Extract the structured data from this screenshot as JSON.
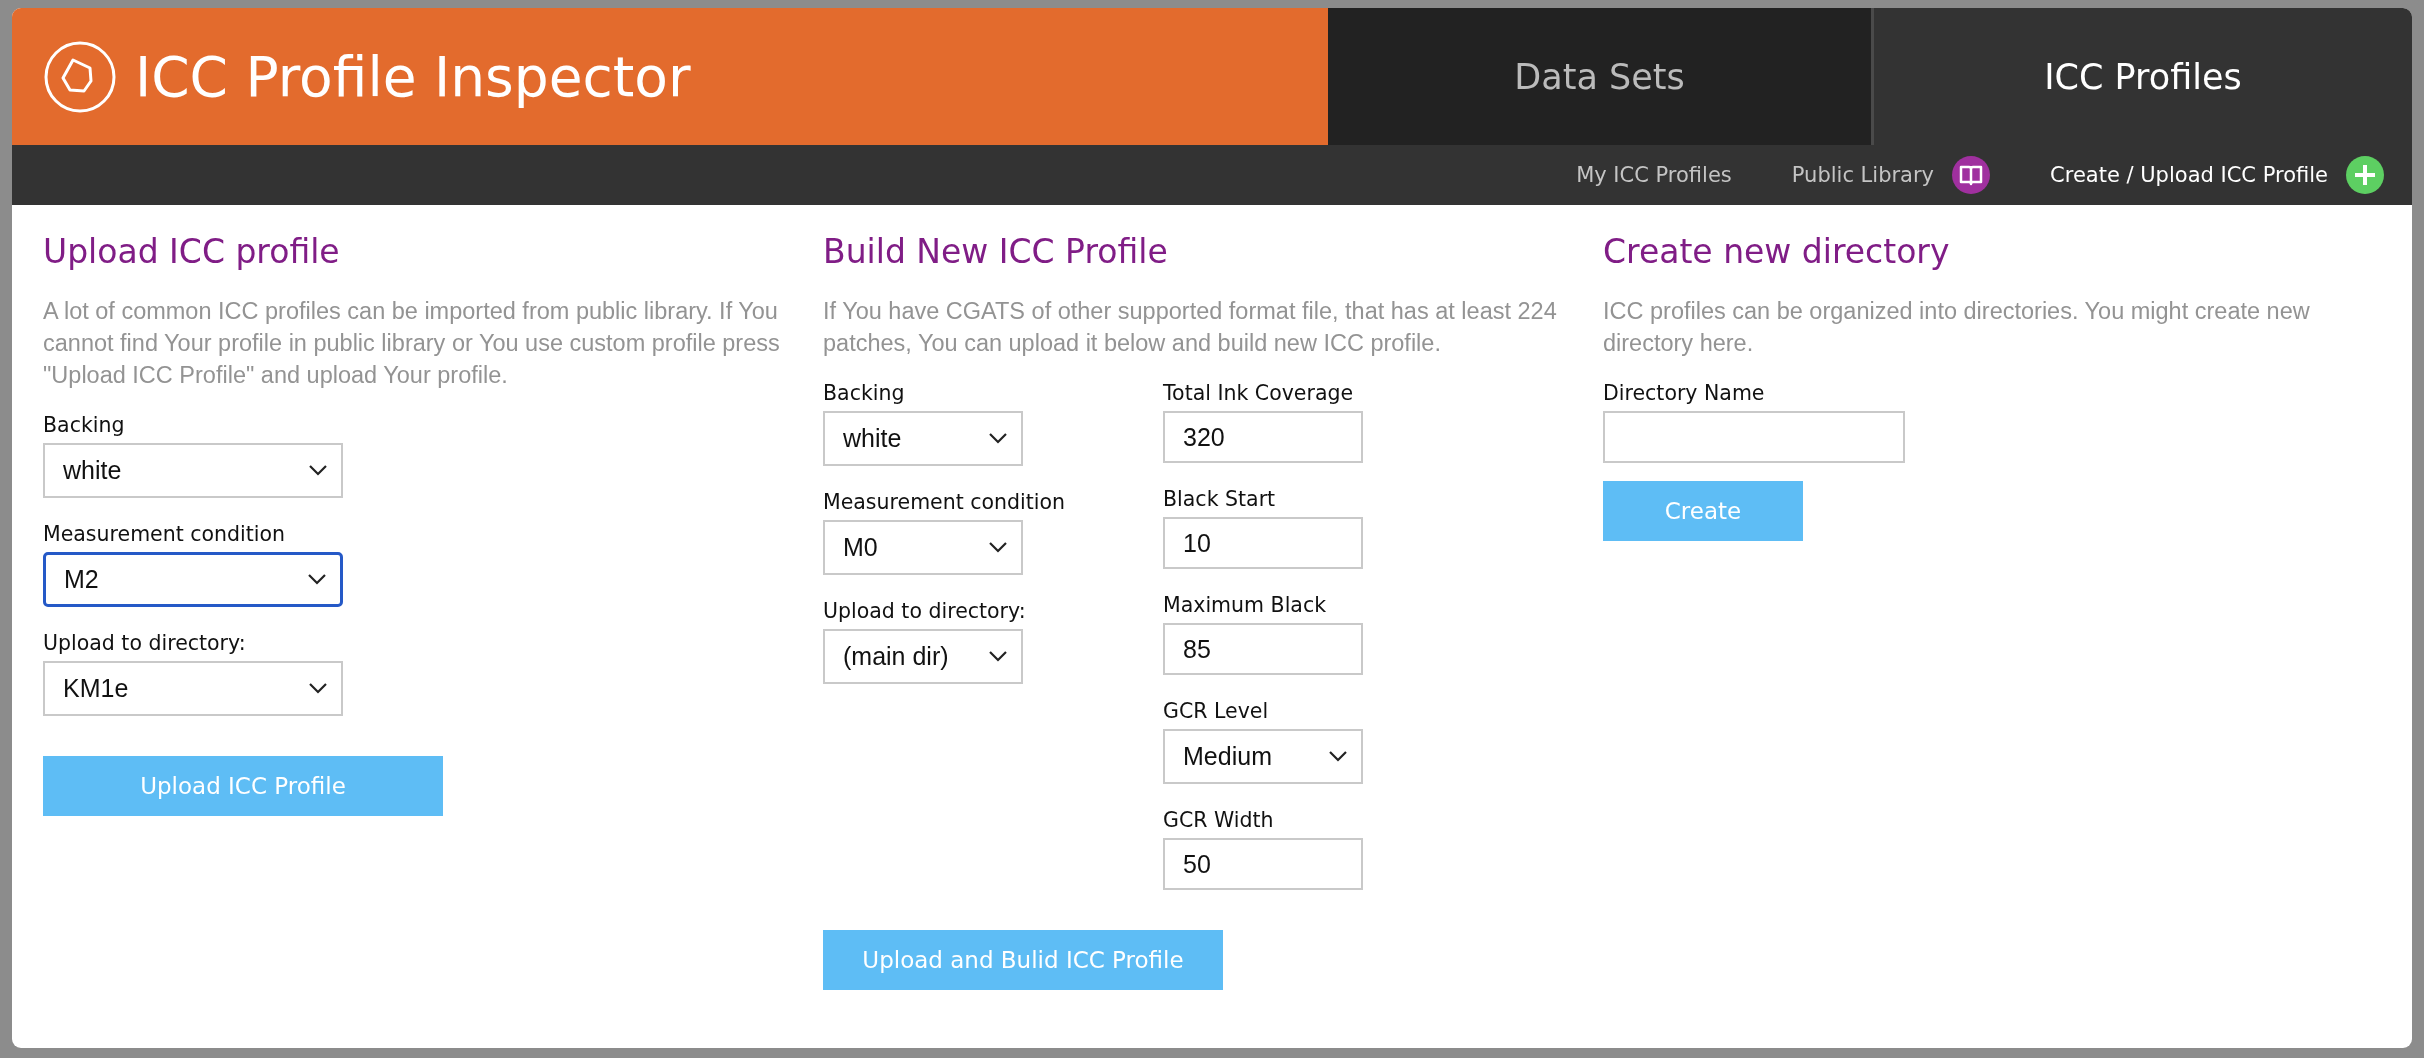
{
  "header": {
    "title": "ICC Profile Inspector",
    "tabs": [
      {
        "label": "Data Sets",
        "selected": false
      },
      {
        "label": "ICC Profiles",
        "selected": true
      }
    ]
  },
  "subnav": [
    {
      "label": "My ICC Profiles",
      "kind": "plain",
      "selected": false
    },
    {
      "label": "Public Library",
      "kind": "book",
      "selected": false
    },
    {
      "label": "Create / Upload ICC Profile",
      "kind": "plus",
      "selected": true
    }
  ],
  "sections": [
    {
      "kind": "upload",
      "title": "Upload ICC profile",
      "description": "A lot of common ICC profiles can be imported from public library. If You cannot find Your profile in public library or You use custom profile press \"Upload ICC Profile\" and upload Your profile.",
      "columns": [
        {
          "fields": [
            {
              "label": "Backing",
              "kind": "select",
              "value": "white",
              "focused": false
            },
            {
              "label": "Measurement condition",
              "kind": "select",
              "value": "M2",
              "focused": true
            },
            {
              "label": "Upload to directory:",
              "kind": "select",
              "value": "KM1e",
              "focused": false
            }
          ]
        }
      ],
      "button": "Upload ICC Profile"
    },
    {
      "kind": "build",
      "title": "Build New ICC Profile",
      "description": "If You have CGATS of other supported format file, that has at least 224 patches, You can upload it below and build new ICC profile.",
      "columns": [
        {
          "fields": [
            {
              "label": "Backing",
              "kind": "select",
              "value": "white",
              "focused": false
            },
            {
              "label": "Measurement condition",
              "kind": "select",
              "value": "M0",
              "focused": false
            },
            {
              "label": "Upload to directory:",
              "kind": "select",
              "value": "(main dir)",
              "focused": false
            }
          ]
        },
        {
          "fields": [
            {
              "label": "Total Ink Coverage",
              "kind": "input",
              "value": "320",
              "focused": false
            },
            {
              "label": "Black Start",
              "kind": "input",
              "value": "10",
              "focused": false
            },
            {
              "label": "Maximum Black",
              "kind": "input",
              "value": "85",
              "focused": false
            },
            {
              "label": "GCR Level",
              "kind": "select",
              "value": "Medium",
              "focused": false
            },
            {
              "label": "GCR Width",
              "kind": "input",
              "value": "50",
              "focused": false
            }
          ]
        }
      ],
      "button": "Upload and Bulid ICC Profile"
    },
    {
      "kind": "directory",
      "title": "Create new directory",
      "description": "ICC profiles can be organized into directories. You might create new directory here.",
      "columns": [
        {
          "fields": [
            {
              "label": "Directory Name",
              "kind": "input",
              "focused": false
            }
          ]
        }
      ],
      "button": "Create"
    }
  ]
}
